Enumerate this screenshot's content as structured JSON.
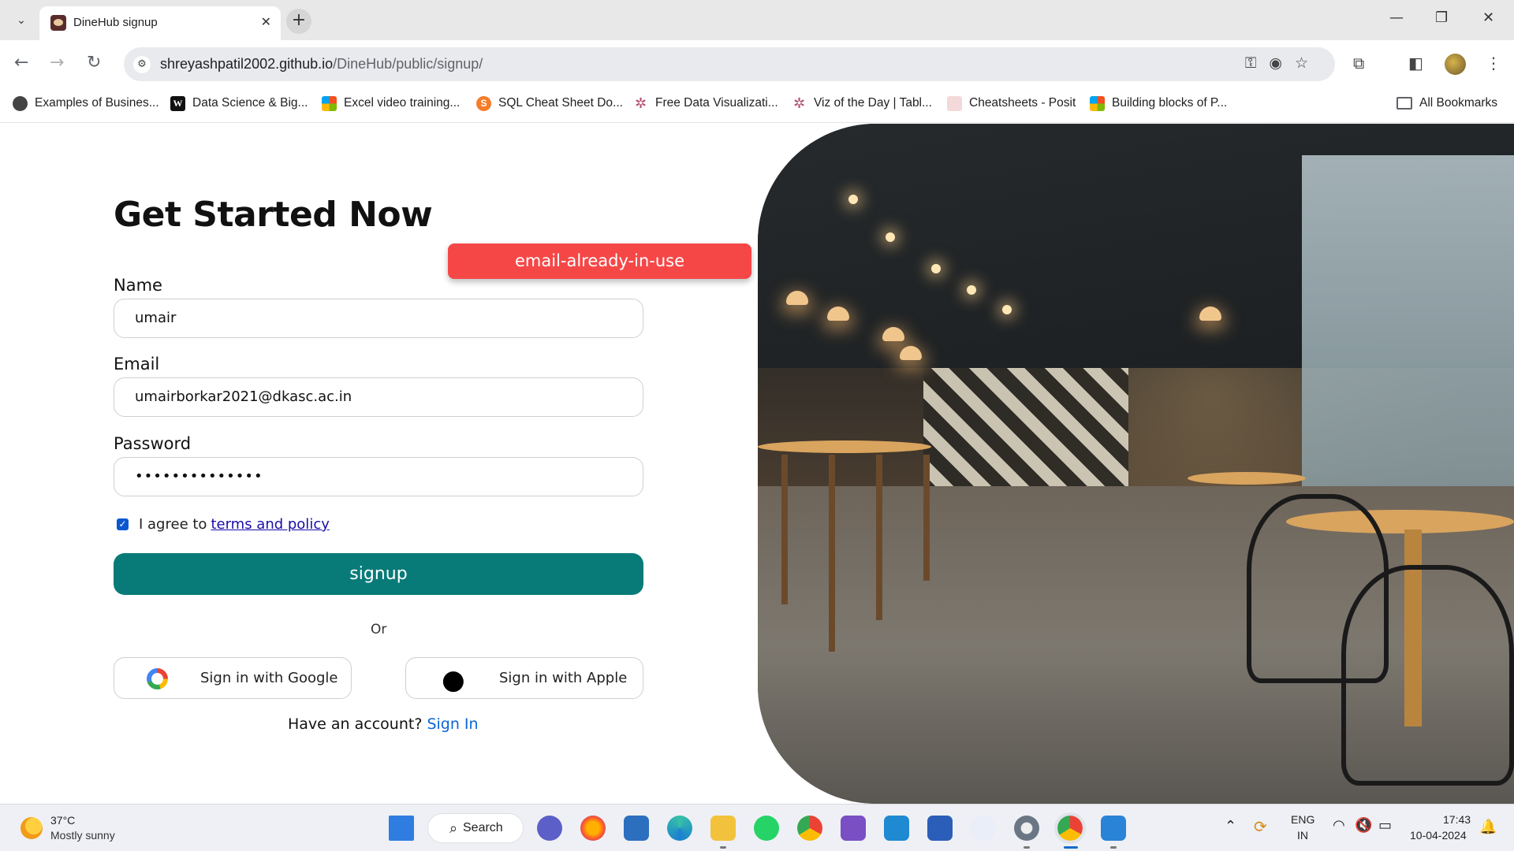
{
  "browser": {
    "tab_title": "DineHub signup",
    "url_host": "shreyashpatil2002.github.io",
    "url_path": "/DineHub/public/signup/",
    "bookmarks": [
      {
        "label": "Examples of Busines...",
        "icon": "globe-icon"
      },
      {
        "label": "Data Science & Big...",
        "icon": "w-icon"
      },
      {
        "label": "Excel video training...",
        "icon": "microsoft-icon"
      },
      {
        "label": "SQL Cheat Sheet Do...",
        "icon": "s-icon"
      },
      {
        "label": "Free Data Visualizati...",
        "icon": "tableau-icon"
      },
      {
        "label": "Viz of the Day | Tabl...",
        "icon": "tableau-icon"
      },
      {
        "label": "Cheatsheets - Posit",
        "icon": "posit-icon"
      },
      {
        "label": "Building blocks of P...",
        "icon": "microsoft-icon"
      }
    ],
    "all_bookmarks": "All Bookmarks"
  },
  "form": {
    "heading": "Get Started Now",
    "error_toast": "email-already-in-use",
    "name_label": "Name",
    "name_value": "umair",
    "email_label": "Email",
    "email_value": "umairborkar2021@dkasc.ac.in",
    "password_label": "Password",
    "password_value": "••••••••••••••",
    "agree_text": "I agree to",
    "terms_link": "terms and policy",
    "agree_checked": true,
    "signup_button": "signup",
    "or_text": "Or",
    "google_button": "Sign in with Google",
    "apple_button": "Sign in with Apple",
    "have_account": "Have an account?",
    "signin_link": "Sign In"
  },
  "taskbar": {
    "temperature": "37°C",
    "weather": "Mostly sunny",
    "search": "Search",
    "lang_top": "ENG",
    "lang_bottom": "IN",
    "time": "17:43",
    "date": "10-04-2024"
  },
  "colors": {
    "accent": "#087b78",
    "error": "#f64747",
    "link": "#0a66d6"
  }
}
